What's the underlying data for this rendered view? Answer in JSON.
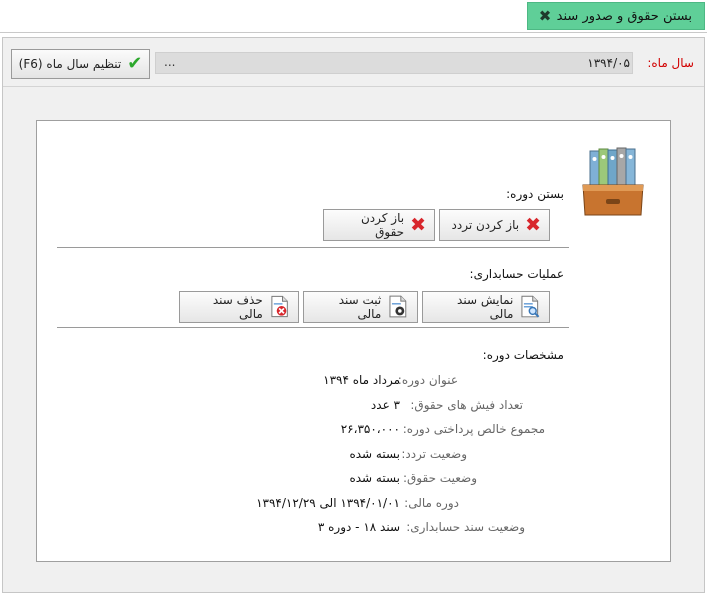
{
  "window": {
    "tab_title": "بستن حقوق و صدور سند",
    "close_icon": "close-icon"
  },
  "toolbar": {
    "year_label": "سال ماه:",
    "year_value": "۱۳۹۴/۰۵",
    "lookup_button": "...",
    "set_button": "تنظیم سال ماه (F6)",
    "set_icon": "check-icon",
    "accent": "#2da82d"
  },
  "close_period": {
    "title": "بستن دوره:",
    "reopen_traffic": "باز کردن تردد",
    "reopen_salary": "باز کردن حقوق"
  },
  "accounting": {
    "title": "عملیات حسابداری:",
    "show_voucher": "نمایش سند مالی",
    "register_voucher": "ثبت سند مالی",
    "delete_voucher": "حذف سند مالی"
  },
  "period_info": {
    "title": "مشخصات دوره:",
    "rows": [
      {
        "label": "عنوان دوره:",
        "value": "مرداد ماه ۱۳۹۴"
      },
      {
        "label": "تعداد فیش های حقوق:",
        "value": "۳ عدد"
      },
      {
        "label": "مجموع خالص پرداختی دوره:",
        "value": "۲۶،۳۵۰،۰۰۰"
      },
      {
        "label": "وضعیت تردد:",
        "value": "بسته شده"
      },
      {
        "label": "وضعیت حقوق:",
        "value": "بسته شده"
      },
      {
        "label": "دوره مالی:",
        "value": "۱۳۹۴/۰۱/۰۱ الی ۱۳۹۴/۱۲/۲۹"
      },
      {
        "label": "وضعیت سند حسابداری:",
        "value": "سند ۱۸ - دوره ۳"
      }
    ]
  },
  "colors": {
    "tab_bg": "#5fcf98",
    "label_red": "#d10000",
    "delete_red": "#d8262c"
  }
}
